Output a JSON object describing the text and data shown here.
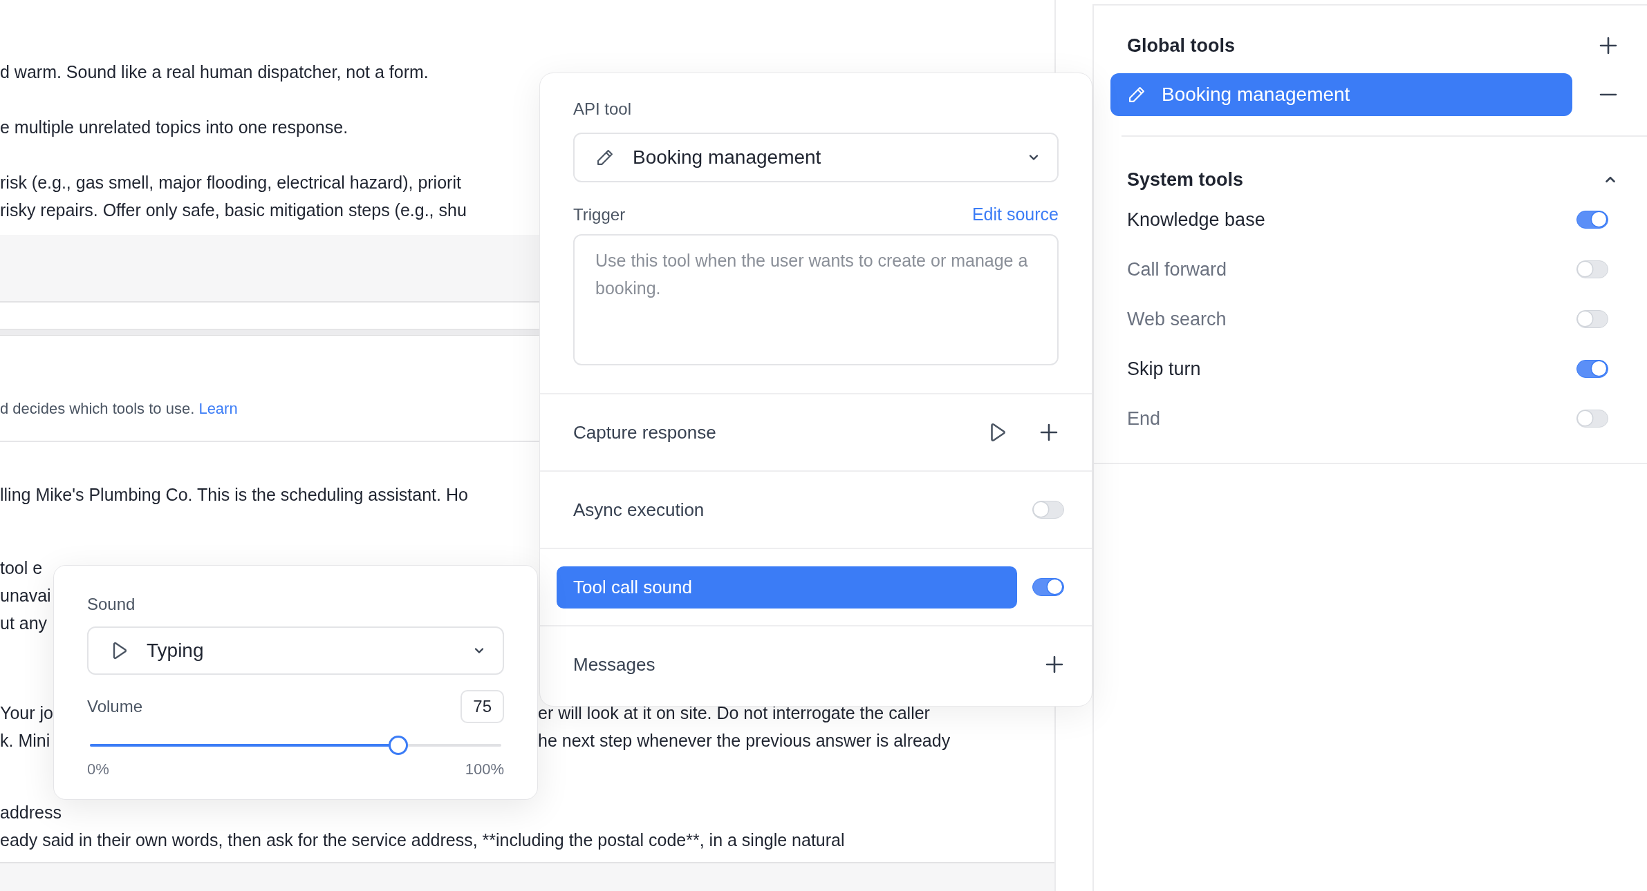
{
  "document": {
    "top_paragraphs": [
      [
        "d warm. Sound like a real human dispatcher, not a form."
      ],
      [
        "e multiple unrelated topics into one response."
      ],
      [
        "risk (e.g., gas smell, major flooding, electrical hazard), priorit",
        "risky repairs. Offer only safe, basic mitigation steps (e.g., shu"
      ]
    ],
    "description": {
      "text": "d decides which tools to use.",
      "link": "Learn"
    },
    "body_paragraphs": [
      [
        {
          "text": "lling Mike's Plumbing Co. This is the scheduling assistant. Ho"
        }
      ],
      [
        {
          "text": "tool e"
        },
        {
          "text": "unavai"
        },
        {
          "text": "ut any"
        }
      ],
      [
        {
          "text": "Your jo",
          "continuation": "er will look at it on site. Do not interrogate the caller"
        },
        {
          "text": "k. Mini",
          "continuation": "he next step whenever the previous answer is already"
        }
      ],
      [
        {
          "text": "address"
        },
        {
          "text": "eady said in their own words, then ask for the service address, **including the postal code**, in a single natural"
        }
      ]
    ]
  },
  "tool_panel": {
    "api_label": "API tool",
    "api_value": "Booking management",
    "trigger_label": "Trigger",
    "edit_link": "Edit source",
    "trigger_placeholder": "Use this tool when the user wants to create or manage a booking.",
    "rows": [
      {
        "kind": "actions",
        "label": "Capture response",
        "selected": false
      },
      {
        "kind": "toggle",
        "label": "Async execution",
        "on": false,
        "selected": false
      },
      {
        "kind": "toggle",
        "label": "Tool call sound",
        "on": true,
        "selected": true
      },
      {
        "kind": "add",
        "label": "Messages",
        "selected": false
      }
    ]
  },
  "sound_popover": {
    "label": "Sound",
    "value": "Typing",
    "volume_label": "Volume",
    "volume_value": "75",
    "level": 0.75,
    "min_label": "0%",
    "max_label": "100%"
  },
  "sidebar": {
    "global_title": "Global tools",
    "global_items": [
      {
        "label": "Booking management",
        "selected": true
      }
    ],
    "system_title": "System tools",
    "system_expanded": true,
    "system_items": [
      {
        "label": "Knowledge base",
        "on": true
      },
      {
        "label": "Call forward",
        "on": false
      },
      {
        "label": "Web search",
        "on": false
      },
      {
        "label": "Skip turn",
        "on": true
      },
      {
        "label": "End",
        "on": false
      }
    ]
  }
}
